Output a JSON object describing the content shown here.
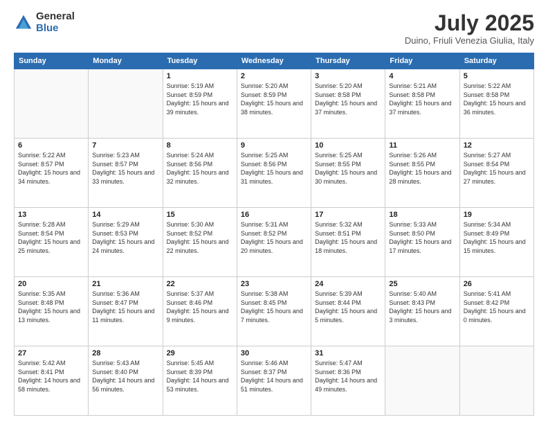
{
  "logo": {
    "general": "General",
    "blue": "Blue"
  },
  "title": "July 2025",
  "subtitle": "Duino, Friuli Venezia Giulia, Italy",
  "days_of_week": [
    "Sunday",
    "Monday",
    "Tuesday",
    "Wednesday",
    "Thursday",
    "Friday",
    "Saturday"
  ],
  "weeks": [
    [
      {
        "day": "",
        "info": ""
      },
      {
        "day": "",
        "info": ""
      },
      {
        "day": "1",
        "info": "Sunrise: 5:19 AM\nSunset: 8:59 PM\nDaylight: 15 hours and 39 minutes."
      },
      {
        "day": "2",
        "info": "Sunrise: 5:20 AM\nSunset: 8:59 PM\nDaylight: 15 hours and 38 minutes."
      },
      {
        "day": "3",
        "info": "Sunrise: 5:20 AM\nSunset: 8:58 PM\nDaylight: 15 hours and 37 minutes."
      },
      {
        "day": "4",
        "info": "Sunrise: 5:21 AM\nSunset: 8:58 PM\nDaylight: 15 hours and 37 minutes."
      },
      {
        "day": "5",
        "info": "Sunrise: 5:22 AM\nSunset: 8:58 PM\nDaylight: 15 hours and 36 minutes."
      }
    ],
    [
      {
        "day": "6",
        "info": "Sunrise: 5:22 AM\nSunset: 8:57 PM\nDaylight: 15 hours and 34 minutes."
      },
      {
        "day": "7",
        "info": "Sunrise: 5:23 AM\nSunset: 8:57 PM\nDaylight: 15 hours and 33 minutes."
      },
      {
        "day": "8",
        "info": "Sunrise: 5:24 AM\nSunset: 8:56 PM\nDaylight: 15 hours and 32 minutes."
      },
      {
        "day": "9",
        "info": "Sunrise: 5:25 AM\nSunset: 8:56 PM\nDaylight: 15 hours and 31 minutes."
      },
      {
        "day": "10",
        "info": "Sunrise: 5:25 AM\nSunset: 8:55 PM\nDaylight: 15 hours and 30 minutes."
      },
      {
        "day": "11",
        "info": "Sunrise: 5:26 AM\nSunset: 8:55 PM\nDaylight: 15 hours and 28 minutes."
      },
      {
        "day": "12",
        "info": "Sunrise: 5:27 AM\nSunset: 8:54 PM\nDaylight: 15 hours and 27 minutes."
      }
    ],
    [
      {
        "day": "13",
        "info": "Sunrise: 5:28 AM\nSunset: 8:54 PM\nDaylight: 15 hours and 25 minutes."
      },
      {
        "day": "14",
        "info": "Sunrise: 5:29 AM\nSunset: 8:53 PM\nDaylight: 15 hours and 24 minutes."
      },
      {
        "day": "15",
        "info": "Sunrise: 5:30 AM\nSunset: 8:52 PM\nDaylight: 15 hours and 22 minutes."
      },
      {
        "day": "16",
        "info": "Sunrise: 5:31 AM\nSunset: 8:52 PM\nDaylight: 15 hours and 20 minutes."
      },
      {
        "day": "17",
        "info": "Sunrise: 5:32 AM\nSunset: 8:51 PM\nDaylight: 15 hours and 18 minutes."
      },
      {
        "day": "18",
        "info": "Sunrise: 5:33 AM\nSunset: 8:50 PM\nDaylight: 15 hours and 17 minutes."
      },
      {
        "day": "19",
        "info": "Sunrise: 5:34 AM\nSunset: 8:49 PM\nDaylight: 15 hours and 15 minutes."
      }
    ],
    [
      {
        "day": "20",
        "info": "Sunrise: 5:35 AM\nSunset: 8:48 PM\nDaylight: 15 hours and 13 minutes."
      },
      {
        "day": "21",
        "info": "Sunrise: 5:36 AM\nSunset: 8:47 PM\nDaylight: 15 hours and 11 minutes."
      },
      {
        "day": "22",
        "info": "Sunrise: 5:37 AM\nSunset: 8:46 PM\nDaylight: 15 hours and 9 minutes."
      },
      {
        "day": "23",
        "info": "Sunrise: 5:38 AM\nSunset: 8:45 PM\nDaylight: 15 hours and 7 minutes."
      },
      {
        "day": "24",
        "info": "Sunrise: 5:39 AM\nSunset: 8:44 PM\nDaylight: 15 hours and 5 minutes."
      },
      {
        "day": "25",
        "info": "Sunrise: 5:40 AM\nSunset: 8:43 PM\nDaylight: 15 hours and 3 minutes."
      },
      {
        "day": "26",
        "info": "Sunrise: 5:41 AM\nSunset: 8:42 PM\nDaylight: 15 hours and 0 minutes."
      }
    ],
    [
      {
        "day": "27",
        "info": "Sunrise: 5:42 AM\nSunset: 8:41 PM\nDaylight: 14 hours and 58 minutes."
      },
      {
        "day": "28",
        "info": "Sunrise: 5:43 AM\nSunset: 8:40 PM\nDaylight: 14 hours and 56 minutes."
      },
      {
        "day": "29",
        "info": "Sunrise: 5:45 AM\nSunset: 8:39 PM\nDaylight: 14 hours and 53 minutes."
      },
      {
        "day": "30",
        "info": "Sunrise: 5:46 AM\nSunset: 8:37 PM\nDaylight: 14 hours and 51 minutes."
      },
      {
        "day": "31",
        "info": "Sunrise: 5:47 AM\nSunset: 8:36 PM\nDaylight: 14 hours and 49 minutes."
      },
      {
        "day": "",
        "info": ""
      },
      {
        "day": "",
        "info": ""
      }
    ]
  ]
}
